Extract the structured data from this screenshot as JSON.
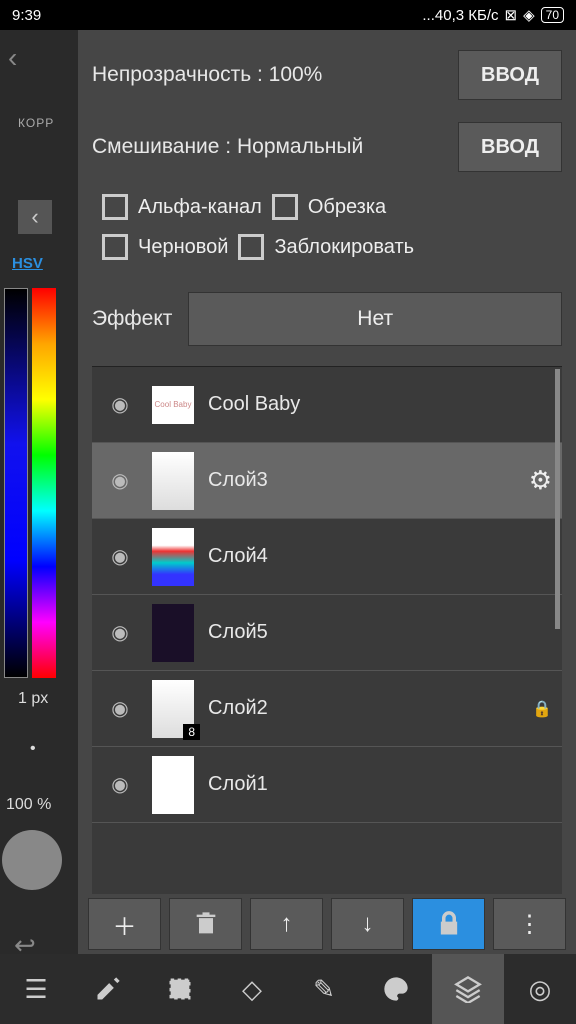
{
  "status": {
    "time": "9:39",
    "speed": "40,3 КБ/с",
    "battery": "70"
  },
  "left": {
    "btn": "КОРР",
    "hsv": "HSV",
    "px": "1 px",
    "pct": "100 %"
  },
  "panel": {
    "opacity_label": "Непрозрачность : 100%",
    "input_btn": "ВВОД",
    "blend_label": "Смешивание : Нормальный",
    "checks": {
      "alpha": "Альфа-канал",
      "clip": "Обрезка",
      "draft": "Черновой",
      "lock": "Заблокировать"
    },
    "effect_label": "Эффект",
    "effect_value": "Нет"
  },
  "layers": [
    {
      "name": "Cool Baby",
      "thumb": "text",
      "selected": false
    },
    {
      "name": "Слой3",
      "thumb": "sketch",
      "selected": true,
      "gear": true
    },
    {
      "name": "Слой4",
      "thumb": "color",
      "selected": false
    },
    {
      "name": "Слой5",
      "thumb": "dark",
      "selected": false
    },
    {
      "name": "Слой2",
      "thumb": "sketch",
      "selected": false,
      "badge": "8",
      "locked": true
    },
    {
      "name": "Слой1",
      "thumb": "blank",
      "selected": false
    }
  ],
  "toolbar": [
    "add",
    "delete",
    "up",
    "down",
    "lock",
    "more"
  ],
  "bottom": [
    "menu",
    "edit",
    "select",
    "rotate",
    "pencil",
    "palette",
    "layers",
    "target"
  ]
}
